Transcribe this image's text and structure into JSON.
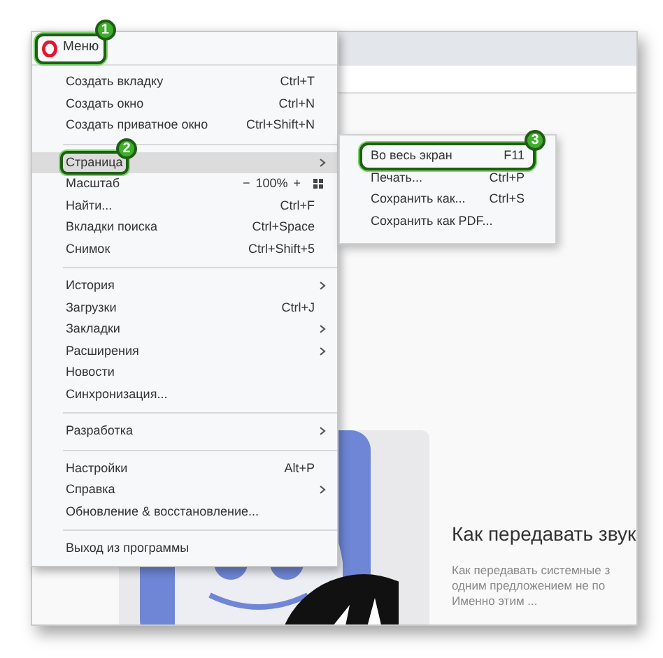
{
  "menu": {
    "title": "Меню",
    "callout": "1",
    "entries": [
      {
        "kind": "item",
        "label": "Создать вкладку",
        "shortcut": "Ctrl+T"
      },
      {
        "kind": "item",
        "label": "Создать окно",
        "shortcut": "Ctrl+N"
      },
      {
        "kind": "item",
        "label": "Создать приватное окно",
        "shortcut": "Ctrl+Shift+N"
      },
      {
        "kind": "separator"
      },
      {
        "kind": "item",
        "label": "Страница",
        "submenu": true,
        "selected": true,
        "callout": "2"
      },
      {
        "kind": "zoom",
        "label": "Масштаб",
        "minus": "−",
        "value": "100%",
        "plus": "+"
      },
      {
        "kind": "item",
        "label": "Найти...",
        "shortcut": "Ctrl+F"
      },
      {
        "kind": "item",
        "label": "Вкладки поиска",
        "shortcut": "Ctrl+Space"
      },
      {
        "kind": "item",
        "label": "Снимок",
        "shortcut": "Ctrl+Shift+5"
      },
      {
        "kind": "separator"
      },
      {
        "kind": "item",
        "label": "История",
        "submenu": true
      },
      {
        "kind": "item",
        "label": "Загрузки",
        "shortcut": "Ctrl+J"
      },
      {
        "kind": "item",
        "label": "Закладки",
        "submenu": true
      },
      {
        "kind": "item",
        "label": "Расширения",
        "submenu": true
      },
      {
        "kind": "item",
        "label": "Новости"
      },
      {
        "kind": "item",
        "label": "Синхронизация..."
      },
      {
        "kind": "separator"
      },
      {
        "kind": "item",
        "label": "Разработка",
        "submenu": true
      },
      {
        "kind": "separator"
      },
      {
        "kind": "item",
        "label": "Настройки",
        "shortcut": "Alt+P"
      },
      {
        "kind": "item",
        "label": "Справка",
        "submenu": true
      },
      {
        "kind": "item",
        "label": "Обновление & восстановление..."
      },
      {
        "kind": "separator"
      },
      {
        "kind": "item",
        "label": "Выход из программы"
      }
    ]
  },
  "submenu": {
    "items": [
      {
        "label": "Во весь экран",
        "shortcut": "F11",
        "callout": "3"
      },
      {
        "label": "Печать...",
        "shortcut": "Ctrl+P"
      },
      {
        "label": "Сохранить как...",
        "shortcut": "Ctrl+S"
      },
      {
        "label": "Сохранить как PDF..."
      }
    ]
  },
  "article": {
    "title": "Как передавать звук",
    "excerpt_lines": [
      "Как передавать системные з",
      "одним предложением не по",
      "Именно этим ..."
    ]
  }
}
